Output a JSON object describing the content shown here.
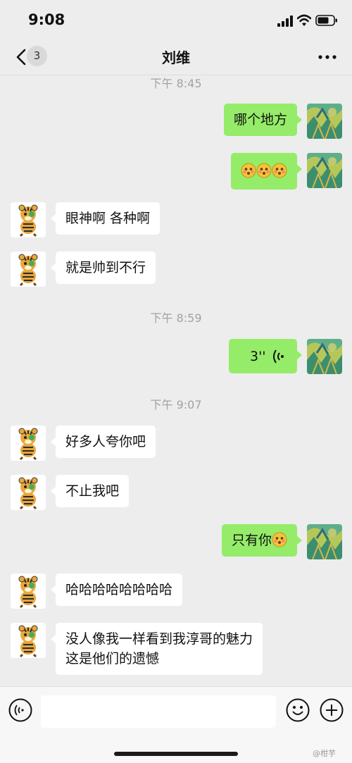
{
  "status_bar": {
    "time": "9:08"
  },
  "nav": {
    "back_count": "3",
    "title": "刘维"
  },
  "timestamps": {
    "t1": "下午 8:45",
    "t2": "下午 8:59",
    "t3": "下午 9:07"
  },
  "messages": {
    "m1": "哪个地方",
    "m3": "眼神啊 各种啊",
    "m4": "就是帅到不行",
    "m5_duration": "3''",
    "m6": "好多人夸你吧",
    "m7": "不止我吧",
    "m8": "只有你",
    "m9": "哈哈哈哈哈哈哈哈",
    "m10_line1": "没人像我一样看到我淳哥的魅力",
    "m10_line2": "这是他们的遗憾"
  },
  "watermark": "@柑芋",
  "colors": {
    "outgoing_bubble": "#95ec69",
    "incoming_bubble": "#ffffff",
    "background": "#ededed"
  },
  "icons": [
    "back-chevron-icon",
    "more-icon",
    "blush-emoji-icon",
    "voice-wave-icon",
    "voice-input-icon",
    "emoji-button-icon",
    "plus-icon",
    "signal-icon",
    "wifi-icon",
    "battery-icon"
  ]
}
